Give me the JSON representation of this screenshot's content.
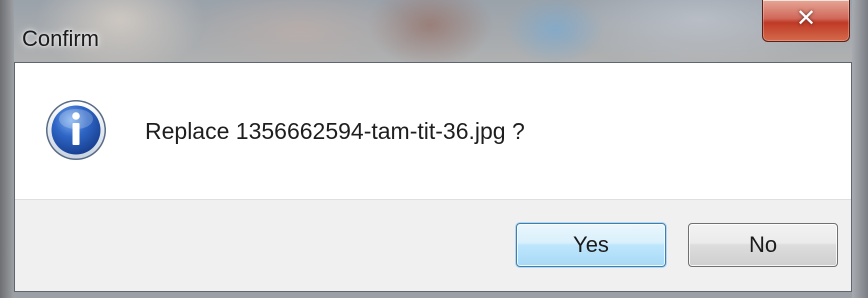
{
  "dialog": {
    "title": "Confirm",
    "message": "Replace 1356662594-tam-tit-36.jpg ?",
    "icon": "info-icon",
    "close_icon": "close-icon"
  },
  "buttons": {
    "yes_label": "Yes",
    "no_label": "No"
  },
  "colors": {
    "close_button": "#c7402c",
    "default_button_border": "#3c7fb1",
    "info_icon_blue": "#2a5ab8"
  }
}
